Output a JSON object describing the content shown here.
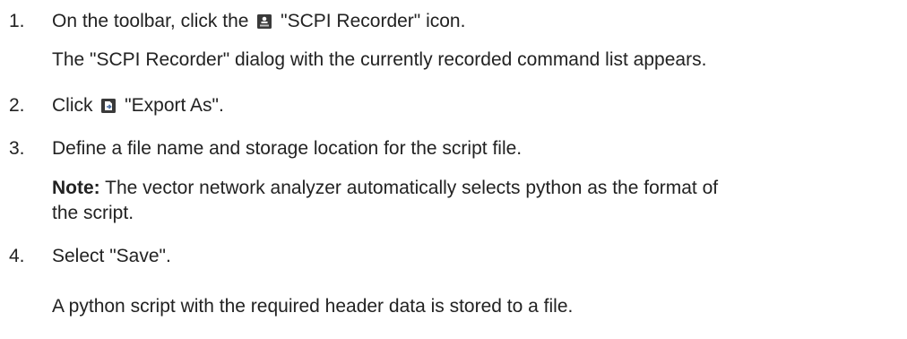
{
  "steps": [
    {
      "number": "1.",
      "pre": "On the toolbar, click the",
      "icon": "scpi-recorder-icon",
      "post": "\"SCPI Recorder\" icon.",
      "result": "The \"SCPI Recorder\" dialog with the currently recorded command list appears."
    },
    {
      "number": "2.",
      "pre": "Click",
      "icon": "export-as-icon",
      "post": "\"Export As\"."
    },
    {
      "number": "3.",
      "text": "Define a file name and storage location for the script file.",
      "note_label": "Note:",
      "note_line1": " The vector network analyzer automatically selects python as the format of",
      "note_line2": "the script."
    },
    {
      "number": "4.",
      "text": "Select \"Save\".",
      "result": "A python script with the required header data is stored to a file."
    }
  ],
  "colors": {
    "text": "#222222",
    "icon_dark": "#3a3a3a",
    "icon_blue": "#4a6fa5"
  }
}
